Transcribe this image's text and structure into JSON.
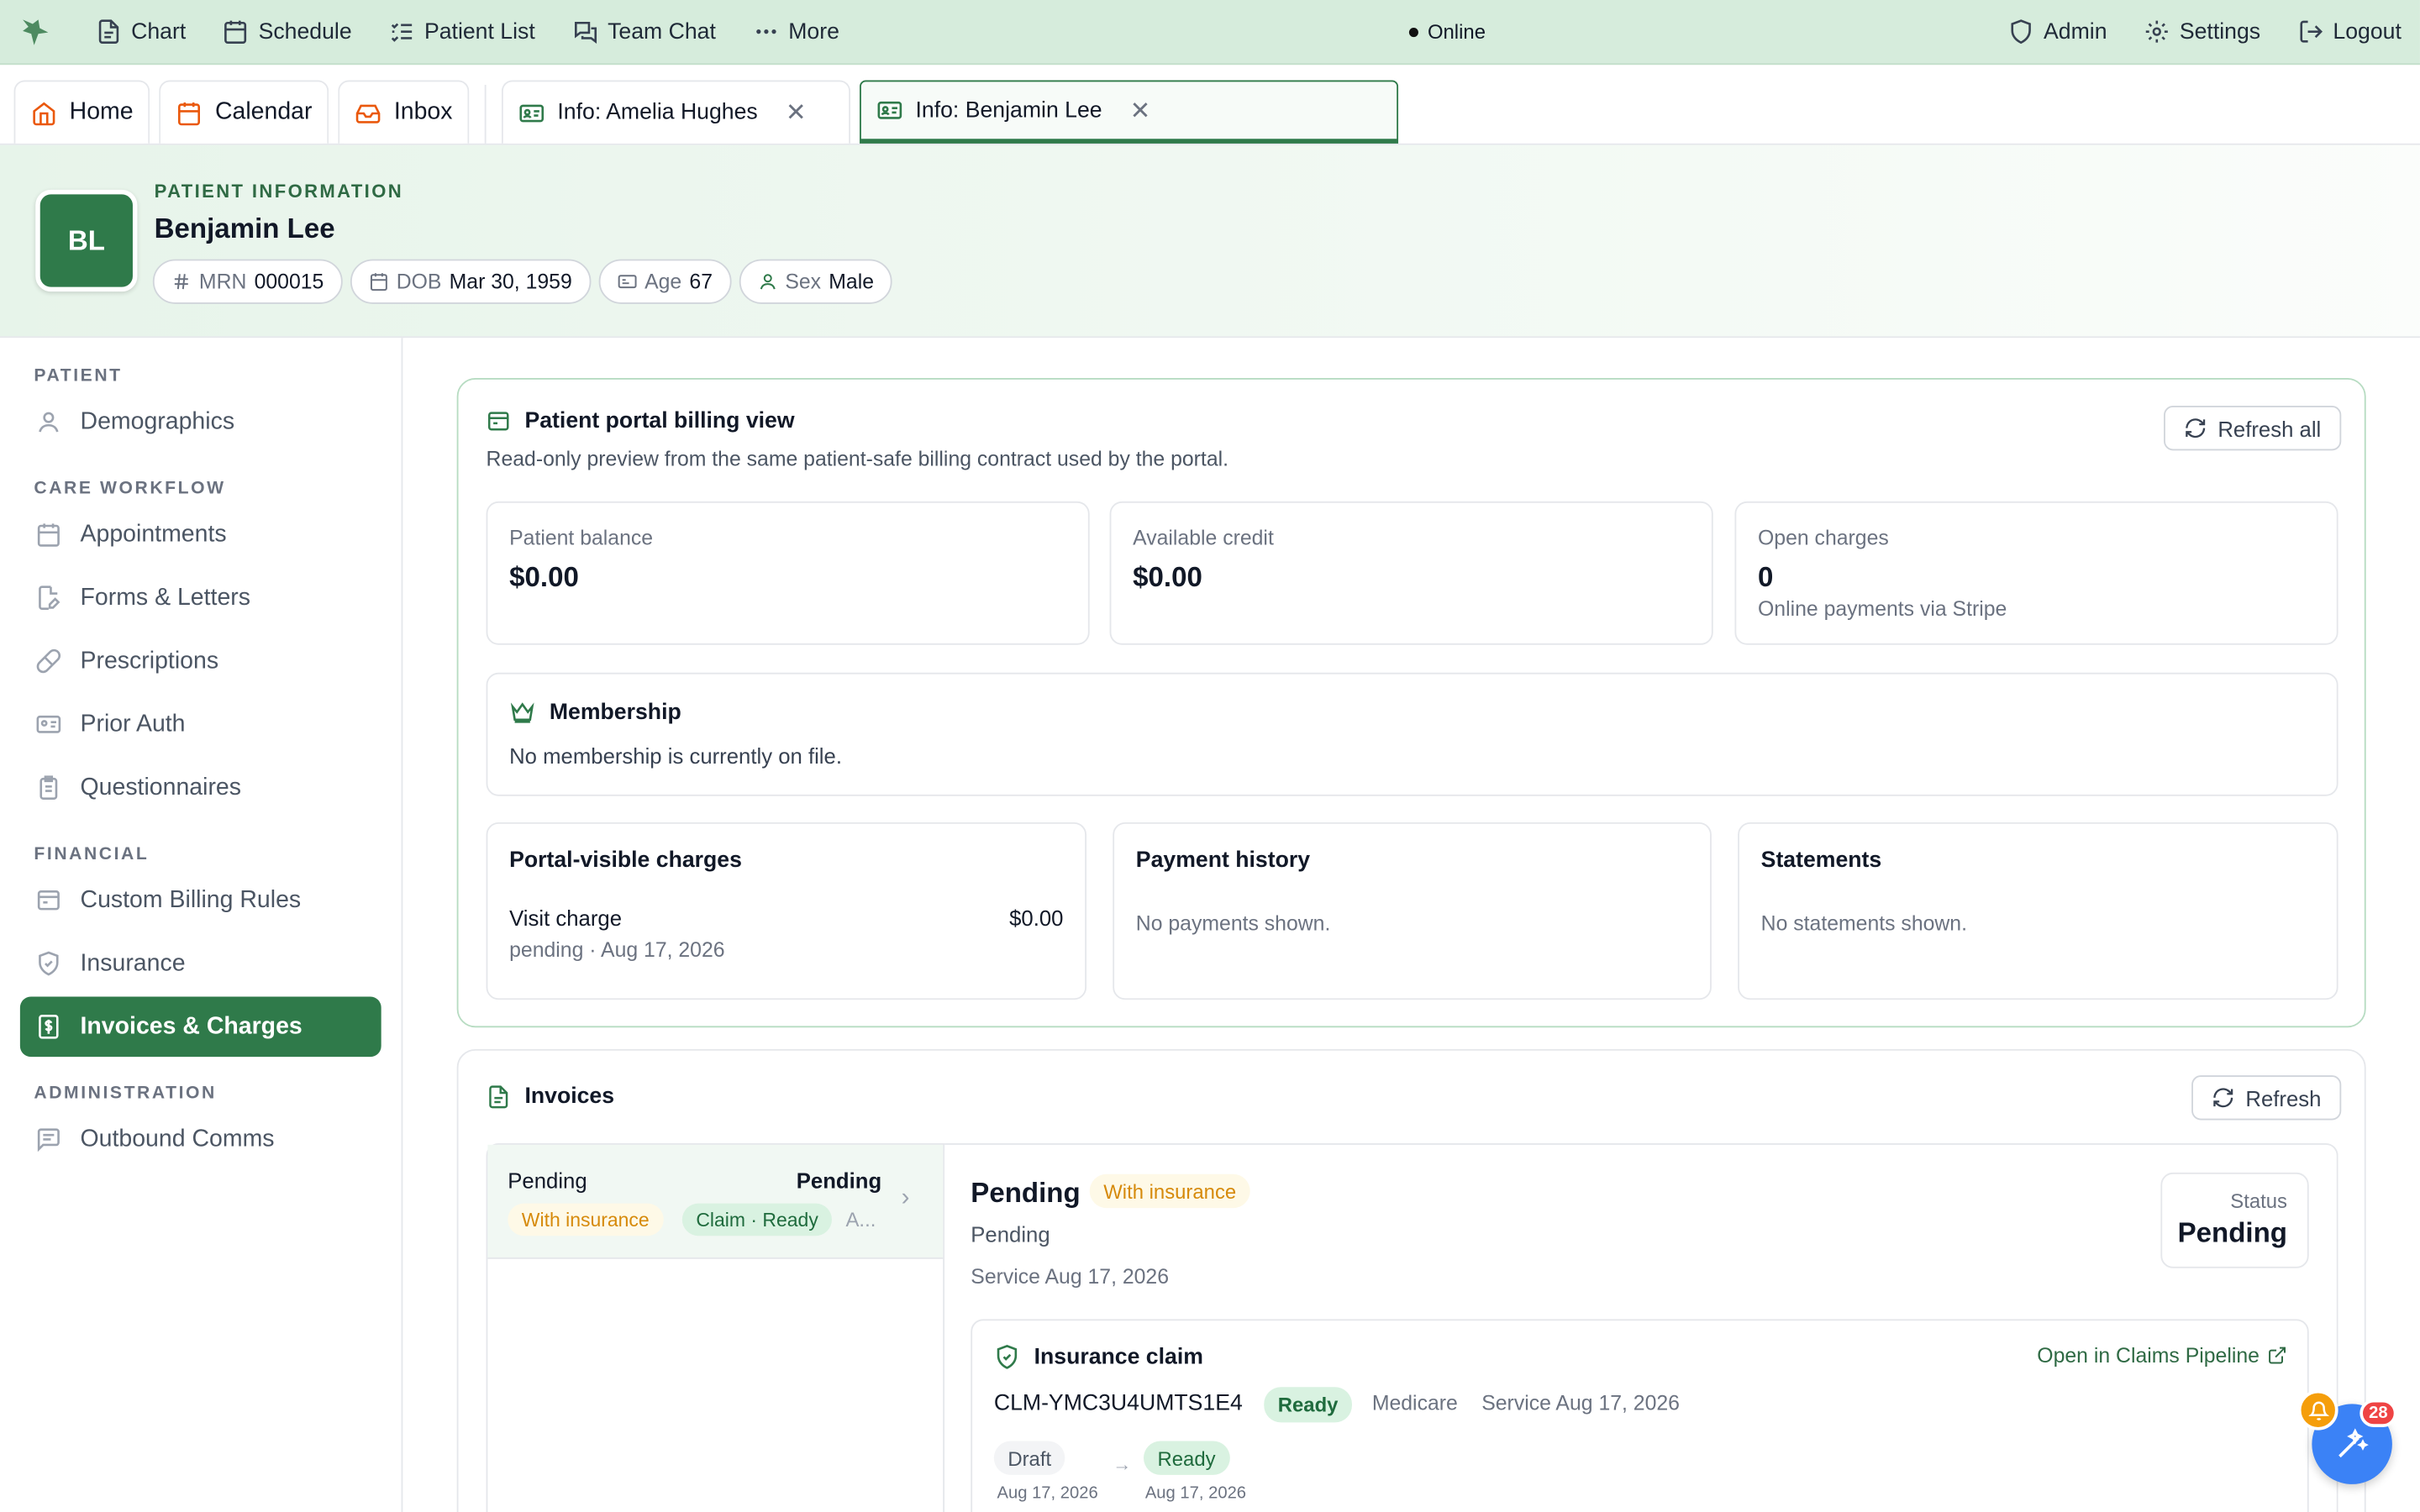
{
  "topnav": {
    "items": [
      {
        "label": "Chart",
        "icon": "file-icon"
      },
      {
        "label": "Schedule",
        "icon": "calendar-icon"
      },
      {
        "label": "Patient List",
        "icon": "list-icon"
      },
      {
        "label": "Team Chat",
        "icon": "chat-icon"
      },
      {
        "label": "More",
        "icon": "more-icon"
      }
    ],
    "status": "Online",
    "right": [
      {
        "label": "Admin",
        "icon": "shield-icon"
      },
      {
        "label": "Settings",
        "icon": "gear-icon"
      },
      {
        "label": "Logout",
        "icon": "logout-icon"
      }
    ]
  },
  "tabs": {
    "home": "Home",
    "calendar": "Calendar",
    "inbox": "Inbox",
    "info1": "Info: Amelia Hughes",
    "info2": "Info: Benjamin Lee"
  },
  "patient": {
    "section_label": "PATIENT INFORMATION",
    "initials": "BL",
    "name": "Benjamin Lee",
    "mrn_label": "MRN",
    "mrn": "000015",
    "dob_label": "DOB",
    "dob": "Mar 30, 1959",
    "age_label": "Age",
    "age": "67",
    "sex_label": "Sex",
    "sex": "Male"
  },
  "sidebar": {
    "sec_patient": "PATIENT",
    "demographics": "Demographics",
    "sec_care": "CARE WORKFLOW",
    "appointments": "Appointments",
    "forms": "Forms & Letters",
    "prescriptions": "Prescriptions",
    "prior_auth": "Prior Auth",
    "questionnaires": "Questionnaires",
    "sec_financial": "FINANCIAL",
    "billing_rules": "Custom Billing Rules",
    "insurance": "Insurance",
    "invoices": "Invoices & Charges",
    "sec_admin": "ADMINISTRATION",
    "outbound": "Outbound Comms"
  },
  "portal": {
    "title": "Patient portal billing view",
    "subtitle": "Read-only preview from the same patient-safe billing contract used by the portal.",
    "refresh_all": "Refresh all",
    "balance_label": "Patient balance",
    "balance": "$0.00",
    "credit_label": "Available credit",
    "credit": "$0.00",
    "open_label": "Open charges",
    "open": "0",
    "open_sub": "Online payments via Stripe",
    "membership_title": "Membership",
    "membership_text": "No membership is currently on file.",
    "charges_title": "Portal-visible charges",
    "charge_name": "Visit charge",
    "charge_amount": "$0.00",
    "charge_meta": "pending · Aug 17, 2026",
    "payments_title": "Payment history",
    "payments_empty": "No payments shown.",
    "statements_title": "Statements",
    "statements_empty": "No statements shown."
  },
  "invoices": {
    "title": "Invoices",
    "refresh": "Refresh",
    "row": {
      "left": "Pending",
      "right": "Pending",
      "pill1": "With insurance",
      "pill2": "Claim · Ready",
      "more": "A..."
    },
    "detail": {
      "title": "Pending",
      "pill": "With insurance",
      "status_text": "Pending",
      "service": "Service Aug 17, 2026",
      "status_label": "Status",
      "status_value": "Pending",
      "claim_title": "Insurance claim",
      "claim_link": "Open in Claims Pipeline",
      "claim_id": "CLM-YMC3U4UMTS1E4",
      "claim_status": "Ready",
      "payer": "Medicare",
      "claim_service": "Service Aug 17, 2026",
      "step1": "Draft",
      "step1_date": "Aug 17, 2026",
      "step2": "Ready",
      "step2_date": "Aug 17, 2026"
    }
  },
  "fab": {
    "badge": "28"
  }
}
